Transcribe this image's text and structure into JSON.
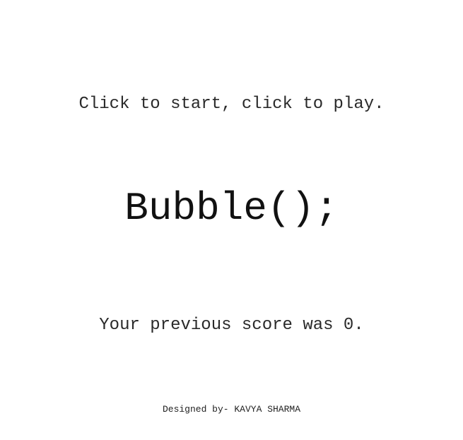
{
  "screen": {
    "instructions": "Click to start, click to play.",
    "title": "Bubble();",
    "score_text": "Your previous score was 0.",
    "previous_score": 0,
    "credit": "Designed by- KAVYA SHARMA"
  },
  "colors": {
    "background": "#ffffff",
    "text": "#111111"
  }
}
